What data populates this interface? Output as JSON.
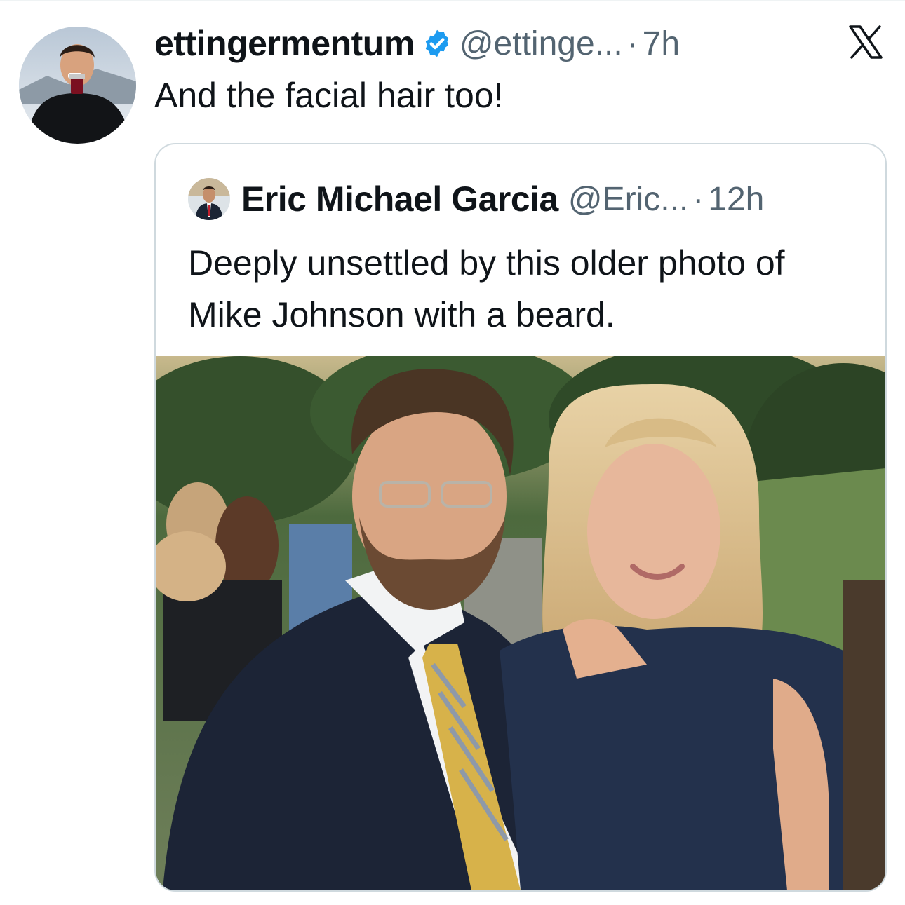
{
  "tweet": {
    "display_name": "ettingermentum",
    "handle": "@ettinge...",
    "separator": "·",
    "time": "7h",
    "text": "And the facial hair too!",
    "verified_icon": "verified-badge-icon",
    "brand_icon": "x-logo-icon",
    "accent_color": "#1d9bf0"
  },
  "quote": {
    "display_name": "Eric Michael Garcia",
    "handle": "@Eric...",
    "separator": "·",
    "time": "12h",
    "text": "Deeply unsettled by this older photo of Mike Johnson with a beard."
  }
}
